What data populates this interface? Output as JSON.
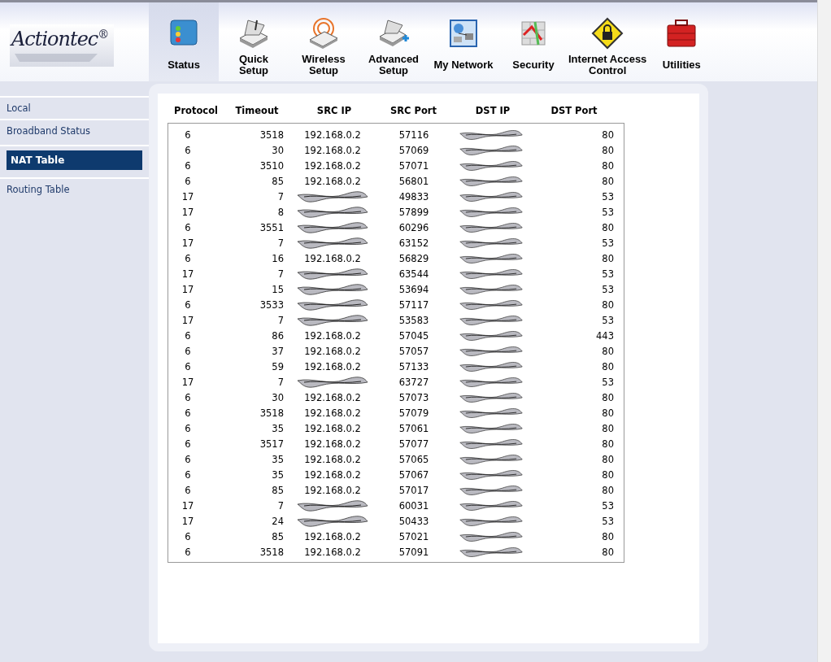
{
  "logo": {
    "brand": "Actiontec",
    "mark": "®"
  },
  "nav": [
    {
      "label": "Status",
      "selected": true
    },
    {
      "label": "Quick\nSetup",
      "selected": false
    },
    {
      "label": "Wireless\nSetup",
      "selected": false
    },
    {
      "label": "Advanced\nSetup",
      "selected": false
    },
    {
      "label": "My Network",
      "selected": false
    },
    {
      "label": "Security",
      "selected": false
    },
    {
      "label": "Internet Access\nControl",
      "selected": false
    },
    {
      "label": "Utilities",
      "selected": false
    }
  ],
  "sidebar": {
    "items": [
      {
        "label": "Local",
        "selected": false
      },
      {
        "label": "Broadband Status",
        "selected": false
      },
      {
        "label": "NAT Table",
        "selected": true
      },
      {
        "label": "Routing Table",
        "selected": false
      }
    ]
  },
  "table": {
    "columns": [
      "Protocol",
      "Timeout",
      "SRC IP",
      "SRC Port",
      "DST IP",
      "DST Port"
    ],
    "rows": [
      [
        "6",
        "3518",
        "192.168.0.2",
        "57116",
        null,
        "80"
      ],
      [
        "6",
        "30",
        "192.168.0.2",
        "57069",
        null,
        "80"
      ],
      [
        "6",
        "3510",
        "192.168.0.2",
        "57071",
        null,
        "80"
      ],
      [
        "6",
        "85",
        "192.168.0.2",
        "56801",
        null,
        "80"
      ],
      [
        "17",
        "7",
        null,
        "49833",
        null,
        "53"
      ],
      [
        "17",
        "8",
        null,
        "57899",
        null,
        "53"
      ],
      [
        "6",
        "3551",
        null,
        "60296",
        null,
        "80"
      ],
      [
        "17",
        "7",
        null,
        "63152",
        null,
        "53"
      ],
      [
        "6",
        "16",
        "192.168.0.2",
        "56829",
        null,
        "80"
      ],
      [
        "17",
        "7",
        null,
        "63544",
        null,
        "53"
      ],
      [
        "17",
        "15",
        null,
        "53694",
        null,
        "53"
      ],
      [
        "6",
        "3533",
        null,
        "57117",
        null,
        "80"
      ],
      [
        "17",
        "7",
        null,
        "53583",
        null,
        "53"
      ],
      [
        "6",
        "86",
        "192.168.0.2",
        "57045",
        null,
        "443"
      ],
      [
        "6",
        "37",
        "192.168.0.2",
        "57057",
        null,
        "80"
      ],
      [
        "6",
        "59",
        "192.168.0.2",
        "57133",
        null,
        "80"
      ],
      [
        "17",
        "7",
        null,
        "63727",
        null,
        "53"
      ],
      [
        "6",
        "30",
        "192.168.0.2",
        "57073",
        null,
        "80"
      ],
      [
        "6",
        "3518",
        "192.168.0.2",
        "57079",
        null,
        "80"
      ],
      [
        "6",
        "35",
        "192.168.0.2",
        "57061",
        null,
        "80"
      ],
      [
        "6",
        "3517",
        "192.168.0.2",
        "57077",
        null,
        "80"
      ],
      [
        "6",
        "35",
        "192.168.0.2",
        "57065",
        null,
        "80"
      ],
      [
        "6",
        "35",
        "192.168.0.2",
        "57067",
        null,
        "80"
      ],
      [
        "6",
        "85",
        "192.168.0.2",
        "57017",
        null,
        "80"
      ],
      [
        "17",
        "7",
        null,
        "60031",
        null,
        "53"
      ],
      [
        "17",
        "24",
        null,
        "50433",
        null,
        "53"
      ],
      [
        "6",
        "85",
        "192.168.0.2",
        "57021",
        null,
        "80"
      ],
      [
        "6",
        "3518",
        "192.168.0.2",
        "57091",
        null,
        "80"
      ]
    ]
  }
}
